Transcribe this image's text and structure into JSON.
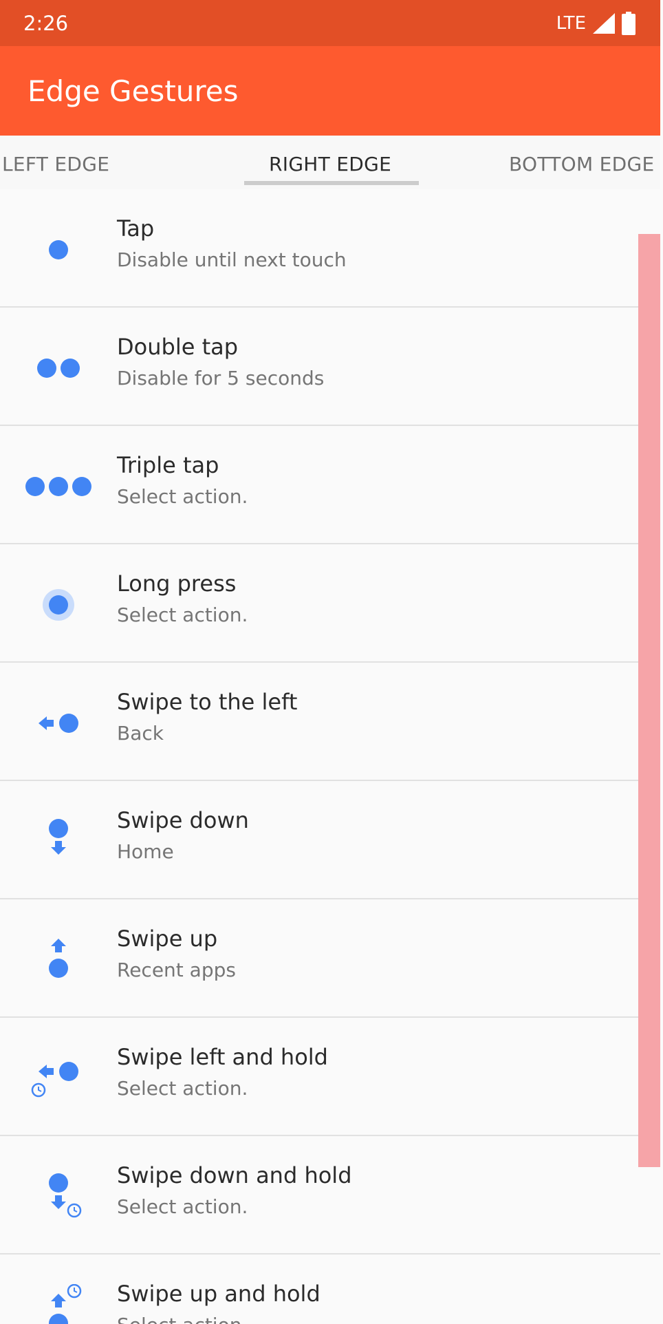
{
  "status_bar": {
    "time": "2:26",
    "network": "LTE"
  },
  "app_bar": {
    "title": "Edge Gestures"
  },
  "tabs": [
    {
      "label": "LEFT EDGE",
      "active": false
    },
    {
      "label": "RIGHT EDGE",
      "active": true
    },
    {
      "label": "BOTTOM EDGE",
      "active": false
    }
  ],
  "gestures": [
    {
      "title": "Tap",
      "subtitle": "Disable until next touch",
      "icon": "tap-icon"
    },
    {
      "title": "Double tap",
      "subtitle": "Disable for 5 seconds",
      "icon": "double-tap-icon"
    },
    {
      "title": "Triple tap",
      "subtitle": "Select action.",
      "icon": "triple-tap-icon"
    },
    {
      "title": "Long press",
      "subtitle": "Select action.",
      "icon": "long-press-icon"
    },
    {
      "title": "Swipe to the left",
      "subtitle": "Back",
      "icon": "swipe-left-icon"
    },
    {
      "title": "Swipe down",
      "subtitle": "Home",
      "icon": "swipe-down-icon"
    },
    {
      "title": "Swipe up",
      "subtitle": "Recent apps",
      "icon": "swipe-up-icon"
    },
    {
      "title": "Swipe left and hold",
      "subtitle": "Select action.",
      "icon": "swipe-left-hold-icon"
    },
    {
      "title": "Swipe down and hold",
      "subtitle": "Select action.",
      "icon": "swipe-down-hold-icon"
    },
    {
      "title": "Swipe up and hold",
      "subtitle": "Select action.",
      "icon": "swipe-up-hold-icon"
    }
  ],
  "colors": {
    "status_bar": "#e24f26",
    "app_bar": "#fe5a2f",
    "icon_blue": "#4285f4",
    "scroll_indicator": "#f6a4a8"
  }
}
